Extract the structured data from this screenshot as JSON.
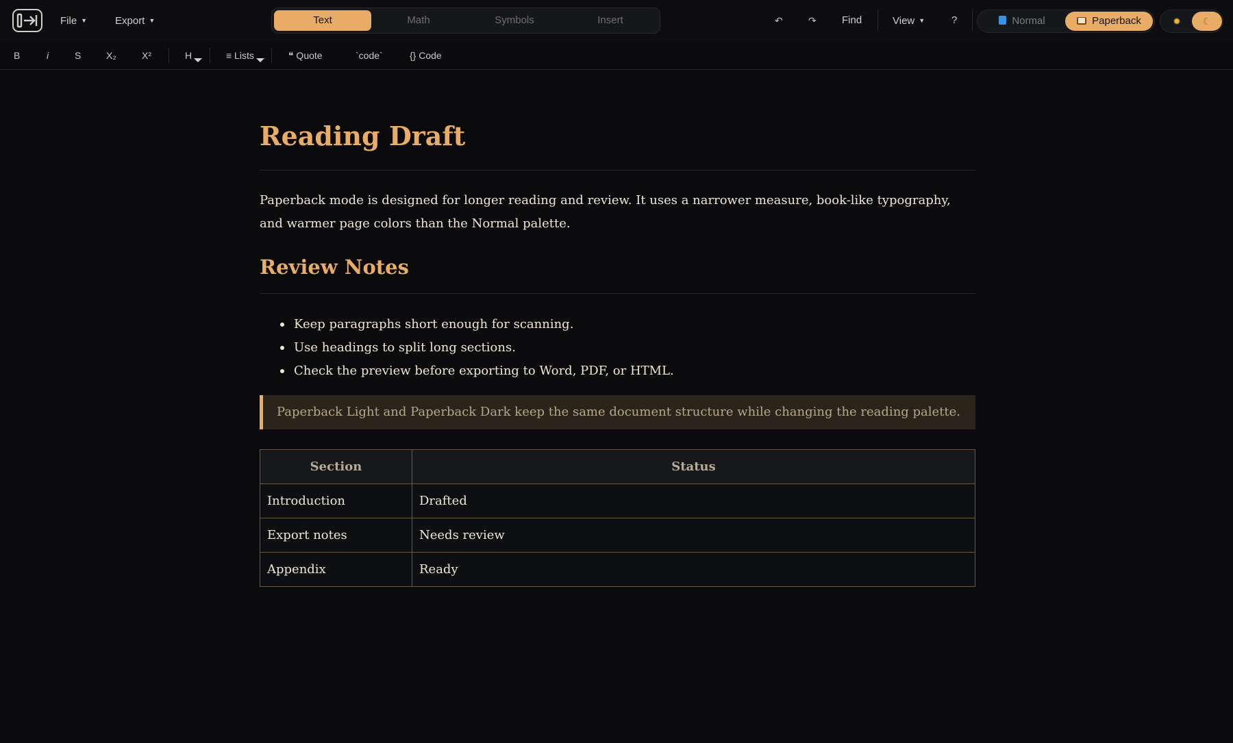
{
  "topbar": {
    "file_label": "File",
    "export_label": "Export",
    "mode_tabs": [
      {
        "label": "Text",
        "active": true
      },
      {
        "label": "Math",
        "active": false
      },
      {
        "label": "Symbols",
        "active": false
      },
      {
        "label": "Insert",
        "active": false
      }
    ],
    "undo_icon": "↶",
    "redo_icon": "↷",
    "find_label": "Find",
    "view_label": "View",
    "help_label": "?",
    "palette": {
      "normal_label": "Normal",
      "paperback_label": "Paperback",
      "active": "Paperback"
    },
    "theme": {
      "light_icon": "sun-icon",
      "dark_icon": "moon-icon",
      "active": "dark"
    }
  },
  "formatbar": {
    "bold": "B",
    "italic": "i",
    "strike": "S",
    "subscript": "X₂",
    "superscript": "X²",
    "heading": "H",
    "lists": "≡ Lists",
    "quote": "❝ Quote",
    "inline_code": "`code`",
    "code_block": "{} Code"
  },
  "document": {
    "title": "Reading Draft",
    "intro": "Paperback mode is designed for longer reading and review. It uses a narrower measure, book-like typography, and warmer page colors than the Normal palette.",
    "section_heading": "Review Notes",
    "bullets": [
      "Keep paragraphs short enough for scanning.",
      "Use headings to split long sections.",
      "Check the preview before exporting to Word, PDF, or HTML."
    ],
    "quote": "Paperback Light and Paperback Dark keep the same document structure while changing the reading palette.",
    "table": {
      "headers": [
        "Section",
        "Status"
      ],
      "rows": [
        [
          "Introduction",
          "Drafted"
        ],
        [
          "Export notes",
          "Needs review"
        ],
        [
          "Appendix",
          "Ready"
        ]
      ]
    }
  },
  "colors": {
    "accent": "#e8ac66",
    "background": "#0b0b0e",
    "text": "#efe6d6"
  }
}
